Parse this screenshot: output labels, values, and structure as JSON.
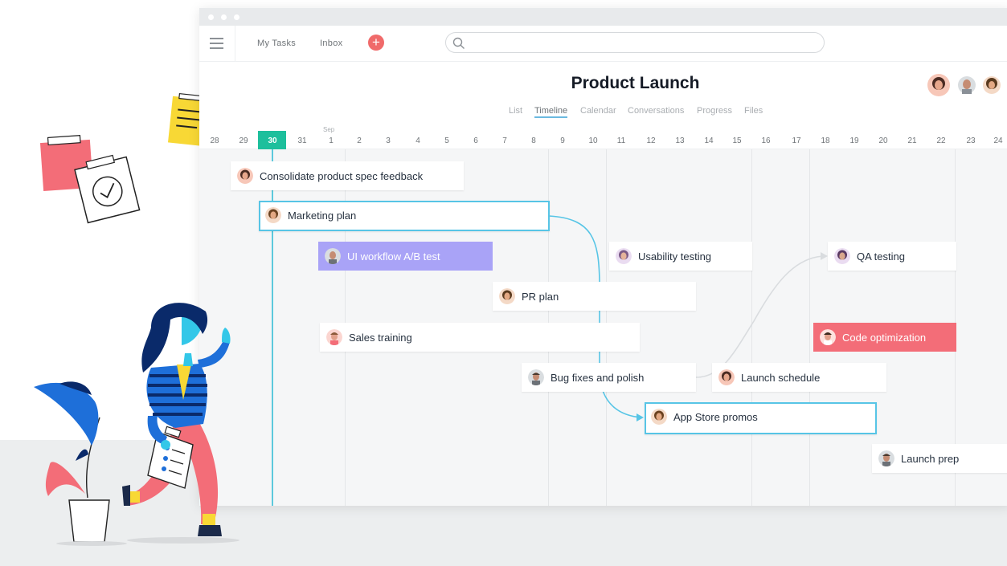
{
  "app": {
    "nav": {
      "my_tasks": "My Tasks",
      "inbox": "Inbox",
      "add": "+"
    },
    "search": {
      "placeholder": ""
    }
  },
  "project": {
    "title": "Product Launch",
    "tabs": [
      {
        "label": "List",
        "active": false
      },
      {
        "label": "Timeline",
        "active": true
      },
      {
        "label": "Calendar",
        "active": false
      },
      {
        "label": "Conversations",
        "active": false
      },
      {
        "label": "Progress",
        "active": false
      },
      {
        "label": "Files",
        "active": false
      }
    ]
  },
  "timeline": {
    "month_label": "Sep",
    "dates": [
      "28",
      "29",
      "30",
      "31",
      "1",
      "2",
      "3",
      "4",
      "5",
      "6",
      "7",
      "8",
      "9",
      "10",
      "11",
      "12",
      "13",
      "14",
      "15",
      "16",
      "17",
      "18",
      "19",
      "20",
      "21",
      "22",
      "23",
      "24"
    ],
    "today": "30",
    "tasks": [
      {
        "name": "Consolidate product spec feedback",
        "style": "default",
        "assignee": "woman-avatar"
      },
      {
        "name": "Marketing plan",
        "style": "selected",
        "assignee": "woman-avatar"
      },
      {
        "name": "UI workflow A/B test",
        "style": "purple",
        "assignee": "man-avatar"
      },
      {
        "name": "Usability testing",
        "style": "default",
        "assignee": "woman-avatar"
      },
      {
        "name": "QA testing",
        "style": "default",
        "assignee": "woman-avatar"
      },
      {
        "name": "PR plan",
        "style": "default",
        "assignee": "woman-avatar"
      },
      {
        "name": "Sales training",
        "style": "default",
        "assignee": "man-avatar"
      },
      {
        "name": "Code optimization",
        "style": "red",
        "assignee": "man-avatar"
      },
      {
        "name": "Bug fixes and polish",
        "style": "default",
        "assignee": "man-avatar"
      },
      {
        "name": "Launch schedule",
        "style": "default",
        "assignee": "woman-avatar"
      },
      {
        "name": "App Store promos",
        "style": "selected",
        "assignee": "woman-avatar"
      },
      {
        "name": "Launch prep",
        "style": "default",
        "assignee": "man-avatar"
      }
    ]
  },
  "colors": {
    "accent_teal": "#1dbf9c",
    "link_blue": "#57c5e6",
    "purple_task": "#a9a3f7",
    "red_task": "#f36d78",
    "add_button": "#f06a6a"
  },
  "icons": [
    "hamburger-icon",
    "plus-icon",
    "search-icon",
    "calendar-check-icon",
    "clipboard-icon",
    "plant-icon"
  ]
}
